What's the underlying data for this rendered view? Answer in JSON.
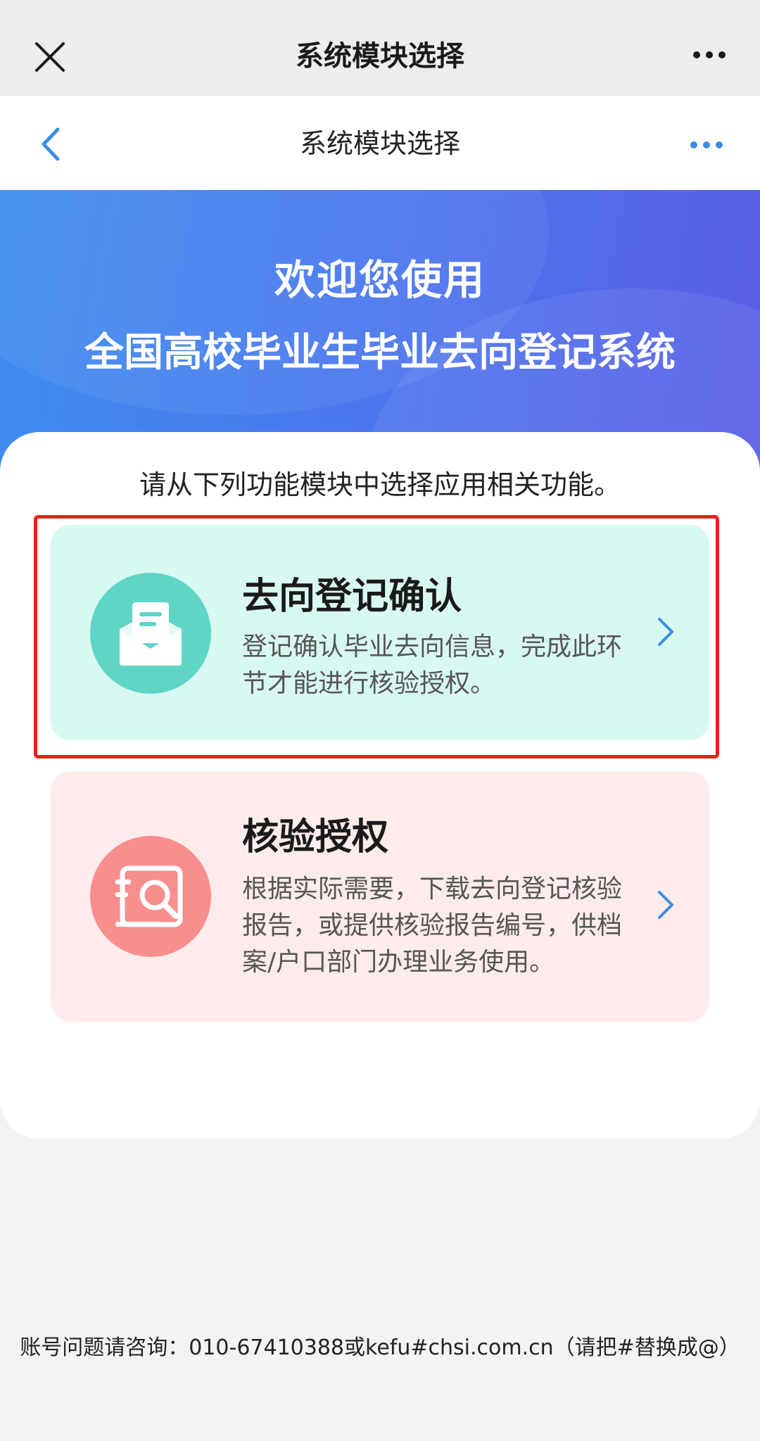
{
  "outer_bar": {
    "title": "系统模块选择",
    "close_icon": "close-icon",
    "more_icon": "more-horizontal-icon"
  },
  "inner_bar": {
    "title": "系统模块选择",
    "back_icon": "chevron-left-icon",
    "more_icon": "more-horizontal-icon",
    "accent_color": "#3a8ee6"
  },
  "banner": {
    "line1": "欢迎您使用",
    "line2": "全国高校毕业生毕业去向登记系统",
    "gradient_start": "#3e8df0",
    "gradient_end": "#5a5ee6"
  },
  "instruction": "请从下列功能模块中选择应用相关功能。",
  "modules": [
    {
      "title": "去向登记确认",
      "description": "登记确认毕业去向信息，完成此环节才能进行核验授权。",
      "icon": "envelope-document-icon",
      "background": "#d8f8f2",
      "icon_color": "#5fd5c6",
      "highlighted": true,
      "highlight_color": "#e8221c"
    },
    {
      "title": "核验授权",
      "description": "根据实际需要，下载去向登记核验报告，或提供核验报告编号，供档案/户口部门办理业务使用。",
      "icon": "document-search-icon",
      "background": "#fdeceb",
      "icon_color": "#f98e8e",
      "highlighted": false
    }
  ],
  "footer": "账号问题请咨询：010-67410388或kefu#chsi.com.cn（请把#替换成@）"
}
